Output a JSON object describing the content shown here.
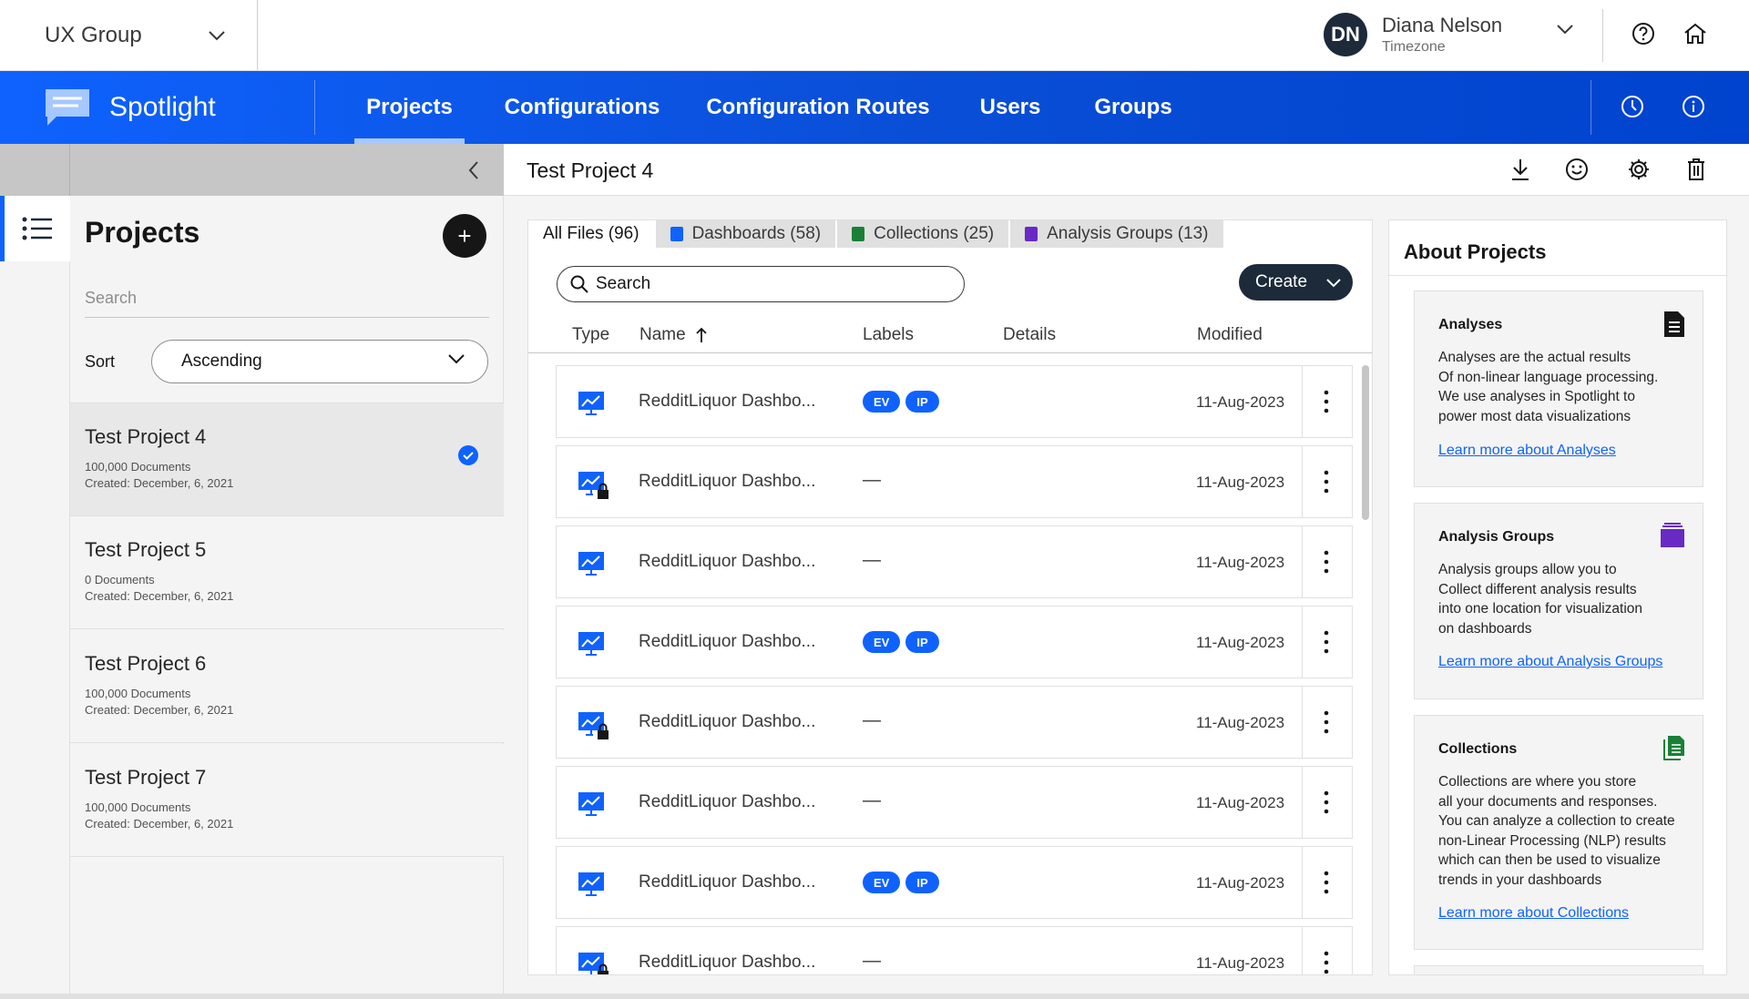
{
  "topbar": {
    "org": "UX Group",
    "user": {
      "initials": "DN",
      "name": "Diana Nelson",
      "subtitle": "Timezone"
    },
    "icons": [
      "help-icon",
      "home-icon"
    ]
  },
  "nav": {
    "brand": "Spotlight",
    "tabs": [
      {
        "label": "Projects",
        "active": true
      },
      {
        "label": "Configurations"
      },
      {
        "label": "Configuration Routes"
      },
      {
        "label": "Users"
      },
      {
        "label": "Groups"
      }
    ],
    "icons": [
      "compass-icon",
      "info-icon"
    ]
  },
  "sidebar": {
    "title": "Projects",
    "add_label": "+",
    "search_placeholder": "Search",
    "sort_label": "Sort",
    "sort_value": "Ascending",
    "projects": [
      {
        "name": "Test Project 4",
        "docs": "100,000 Documents",
        "created": "Created: December, 6, 2021",
        "selected": true
      },
      {
        "name": "Test Project 5",
        "docs": "0 Documents",
        "created": "Created: December, 6, 2021"
      },
      {
        "name": "Test Project 6",
        "docs": "100,000 Documents",
        "created": "Created: December, 6, 2021"
      },
      {
        "name": "Test Project 7",
        "docs": "100,000 Documents",
        "created": "Created: December, 6, 2021"
      }
    ]
  },
  "main": {
    "title": "Test Project 4",
    "tabs": [
      {
        "label": "All Files (96)",
        "active": true
      },
      {
        "label": "Dashboards (58)",
        "color": "#0f62fe"
      },
      {
        "label": "Collections (25)",
        "color": "#198038"
      },
      {
        "label": "Analysis Groups (13)",
        "color": "#6929c4"
      }
    ],
    "search_label": "Search",
    "create_label": "Create",
    "columns": {
      "type": "Type",
      "name": "Name",
      "labels": "Labels",
      "details": "Details",
      "modified": "Modified"
    },
    "rows": [
      {
        "name": "RedditLiquor Dashbo...",
        "labels": [
          "EV",
          "IP"
        ],
        "locked": false,
        "modified": "11-Aug-2023"
      },
      {
        "name": "RedditLiquor Dashbo...",
        "labels": [],
        "dash": "—",
        "locked": true,
        "modified": "11-Aug-2023"
      },
      {
        "name": "RedditLiquor Dashbo...",
        "labels": [],
        "dash": "—",
        "locked": false,
        "modified": "11-Aug-2023"
      },
      {
        "name": "RedditLiquor Dashbo...",
        "labels": [
          "EV",
          "IP"
        ],
        "locked": false,
        "modified": "11-Aug-2023"
      },
      {
        "name": "RedditLiquor Dashbo...",
        "labels": [],
        "dash": "—",
        "locked": true,
        "modified": "11-Aug-2023"
      },
      {
        "name": "RedditLiquor Dashbo...",
        "labels": [],
        "dash": "—",
        "locked": false,
        "modified": "11-Aug-2023"
      },
      {
        "name": "RedditLiquor Dashbo...",
        "labels": [
          "EV",
          "IP"
        ],
        "locked": false,
        "modified": "11-Aug-2023"
      },
      {
        "name": "RedditLiquor Dashbo...",
        "labels": [],
        "dash": "—",
        "locked": true,
        "modified": "11-Aug-2023"
      }
    ]
  },
  "about": {
    "title": "About Projects",
    "cards": [
      {
        "title": "Analyses",
        "icon": "document-icon",
        "lines": [
          "Analyses are the actual results",
          "Of non-linear language processing.",
          "We use analyses in Spotlight to",
          "power most data visualizations"
        ],
        "link": "Learn more about Analyses"
      },
      {
        "title": "Analysis Groups",
        "icon": "stack-icon",
        "lines": [
          "Analysis groups allow you to",
          "Collect different analysis results",
          "into one location for visualization",
          "on dashboards"
        ],
        "link": "Learn more about Analysis Groups"
      },
      {
        "title": "Collections",
        "icon": "collection-icon",
        "lines": [
          "Collections are where you store",
          "all your documents and responses.",
          "You can analyze a collection to create",
          "non-Linear Processing (NLP) results",
          "which can then be used to visualize",
          "trends in your dashboards"
        ],
        "link": "Learn more about Collections"
      }
    ]
  },
  "colors": {
    "brand": "#0f62fe",
    "nav_end": "#0043ce",
    "dark": "#1c2a3a",
    "collections": "#198038",
    "analysis_groups": "#6929c4"
  }
}
